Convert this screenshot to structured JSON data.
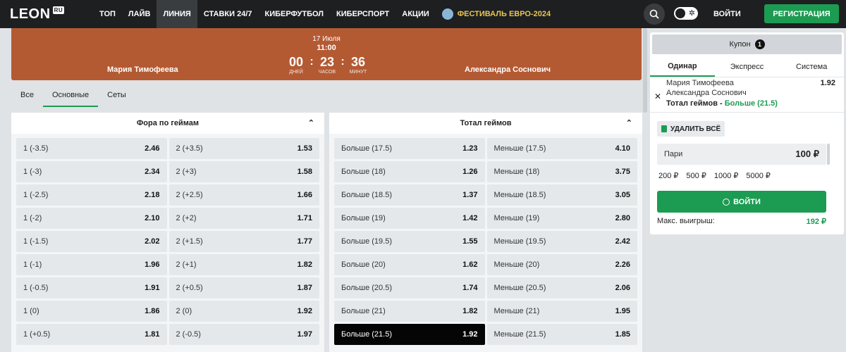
{
  "nav": {
    "logo": "LEON",
    "logo_suffix": "RU",
    "items": [
      "ТОП",
      "ЛАЙВ",
      "ЛИНИЯ",
      "СТАВКИ 24/7",
      "КИБЕРФУТБОЛ",
      "КИБЕРСПОРТ",
      "АКЦИИ"
    ],
    "active_item": "ЛИНИЯ",
    "festival": "ФЕСТИВАЛЬ ЕВРО-2024",
    "login": "ВОЙТИ",
    "register": "РЕГИСТРАЦИЯ"
  },
  "match": {
    "date": "17 Июля",
    "time": "11:00",
    "team1": "Мария Тимофеева",
    "team2": "Александра Соснович",
    "countdown": [
      {
        "value": "00",
        "label": "ДНЕЙ"
      },
      {
        "value": "23",
        "label": "ЧАСОВ"
      },
      {
        "value": "36",
        "label": "МИНУТ"
      }
    ]
  },
  "tabs": [
    "Все",
    "Основные",
    "Сеты"
  ],
  "active_tab": "Основные",
  "markets": [
    {
      "title": "Фора по геймам",
      "rows": [
        [
          {
            "label": "1 (-3.5)",
            "odds": "2.46"
          },
          {
            "label": "2 (+3.5)",
            "odds": "1.53"
          }
        ],
        [
          {
            "label": "1 (-3)",
            "odds": "2.34"
          },
          {
            "label": "2 (+3)",
            "odds": "1.58"
          }
        ],
        [
          {
            "label": "1 (-2.5)",
            "odds": "2.18"
          },
          {
            "label": "2 (+2.5)",
            "odds": "1.66"
          }
        ],
        [
          {
            "label": "1 (-2)",
            "odds": "2.10"
          },
          {
            "label": "2 (+2)",
            "odds": "1.71"
          }
        ],
        [
          {
            "label": "1 (-1.5)",
            "odds": "2.02"
          },
          {
            "label": "2 (+1.5)",
            "odds": "1.77"
          }
        ],
        [
          {
            "label": "1 (-1)",
            "odds": "1.96"
          },
          {
            "label": "2 (+1)",
            "odds": "1.82"
          }
        ],
        [
          {
            "label": "1 (-0.5)",
            "odds": "1.91"
          },
          {
            "label": "2 (+0.5)",
            "odds": "1.87"
          }
        ],
        [
          {
            "label": "1 (0)",
            "odds": "1.86"
          },
          {
            "label": "2 (0)",
            "odds": "1.92"
          }
        ],
        [
          {
            "label": "1 (+0.5)",
            "odds": "1.81"
          },
          {
            "label": "2 (-0.5)",
            "odds": "1.97"
          }
        ]
      ]
    },
    {
      "title": "Тотал геймов",
      "rows": [
        [
          {
            "label": "Больше (17.5)",
            "odds": "1.23"
          },
          {
            "label": "Меньше (17.5)",
            "odds": "4.10"
          }
        ],
        [
          {
            "label": "Больше (18)",
            "odds": "1.26"
          },
          {
            "label": "Меньше (18)",
            "odds": "3.75"
          }
        ],
        [
          {
            "label": "Больше (18.5)",
            "odds": "1.37"
          },
          {
            "label": "Меньше (18.5)",
            "odds": "3.05"
          }
        ],
        [
          {
            "label": "Больше (19)",
            "odds": "1.42"
          },
          {
            "label": "Меньше (19)",
            "odds": "2.80"
          }
        ],
        [
          {
            "label": "Больше (19.5)",
            "odds": "1.55"
          },
          {
            "label": "Меньше (19.5)",
            "odds": "2.42"
          }
        ],
        [
          {
            "label": "Больше (20)",
            "odds": "1.62"
          },
          {
            "label": "Меньше (20)",
            "odds": "2.26"
          }
        ],
        [
          {
            "label": "Больше (20.5)",
            "odds": "1.74"
          },
          {
            "label": "Меньше (20.5)",
            "odds": "2.06"
          }
        ],
        [
          {
            "label": "Больше (21)",
            "odds": "1.82"
          },
          {
            "label": "Меньше (21)",
            "odds": "1.95"
          }
        ],
        [
          {
            "label": "Больше (21.5)",
            "odds": "1.92",
            "selected": true
          },
          {
            "label": "Меньше (21.5)",
            "odds": "1.85"
          }
        ]
      ]
    }
  ],
  "coupon": {
    "title": "Купон",
    "count": "1",
    "tabs": [
      "Одинар",
      "Экспресс",
      "Система"
    ],
    "active_tab": "Одинар",
    "bet": {
      "team1": "Мария Тимофеева",
      "team2": "Александра Соснович",
      "market": "Тотал геймов - ",
      "selection": "Больше (21.5)",
      "odds": "1.92"
    },
    "delete_all": "УДАЛИТЬ ВСЁ",
    "stake_label": "Пари",
    "stake_value": "100 ₽",
    "quick_amounts": [
      "200 ₽",
      "500 ₽",
      "1000 ₽",
      "5000 ₽"
    ],
    "login_button": "ВОЙТИ",
    "max_win_label": "Макс. выигрыш:",
    "max_win_value": "192 ₽"
  },
  "colors": {
    "brand_green": "#1c9b52",
    "header_bg": "#b45a33",
    "nav_bg": "#1d1f21",
    "festival_gold": "#e9c64f"
  },
  "icons": {
    "search": "search-icon",
    "theme": "sun-icon",
    "trash": "trash-icon",
    "user": "user-icon",
    "close": "close-icon",
    "collapse": "chevron-up-icon"
  }
}
